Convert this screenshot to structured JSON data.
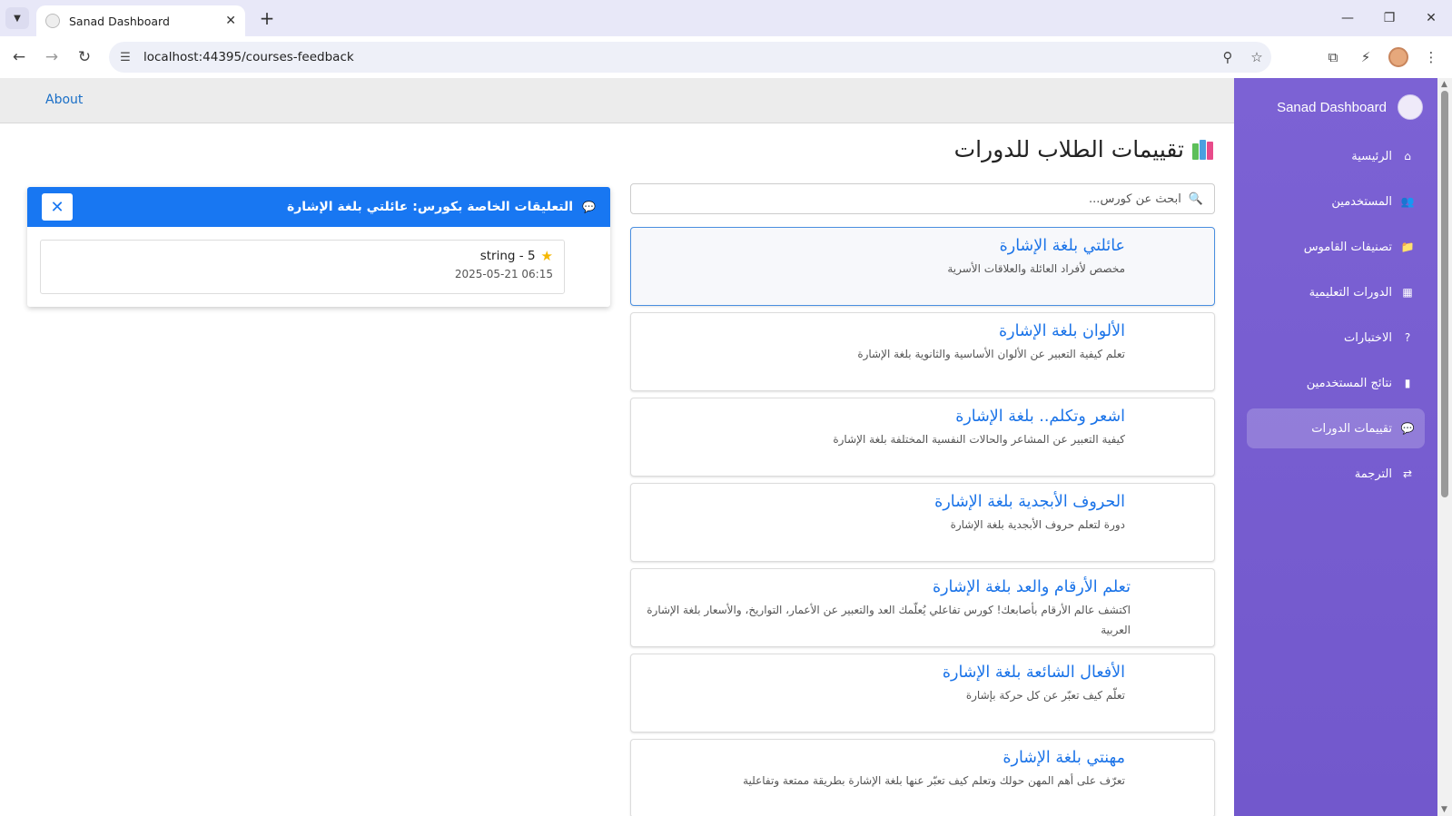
{
  "browser": {
    "tab_title": "Sanad Dashboard",
    "url": "localhost:44395/courses-feedback"
  },
  "topbar": {
    "about_label": "About"
  },
  "sidebar": {
    "brand": "Sanad Dashboard",
    "items": [
      {
        "label": "الرئيسية",
        "icon": "home-icon"
      },
      {
        "label": "المستخدمين",
        "icon": "users-icon"
      },
      {
        "label": "تصنيفات القاموس",
        "icon": "folder-icon"
      },
      {
        "label": "الدورات التعليمية",
        "icon": "board-icon"
      },
      {
        "label": "الاختبارات",
        "icon": "question-icon"
      },
      {
        "label": "نتائج المستخدمين",
        "icon": "chart-icon"
      },
      {
        "label": "تقييمات الدورات",
        "icon": "comment-icon"
      },
      {
        "label": "الترجمة",
        "icon": "translate-icon"
      }
    ],
    "active_index": 6
  },
  "main": {
    "title": "تقييمات الطلاب للدورات",
    "search_placeholder": "ابحث عن كورس...",
    "courses": [
      {
        "title": "عائلتي بلغة الإشارة",
        "desc": "مخصص لأفراد العائلة والعلاقات الأسرية"
      },
      {
        "title": "الألوان بلغة الإشارة",
        "desc": "تعلم كيفية التعبير عن الألوان الأساسية والثانوية بلغة الإشارة"
      },
      {
        "title": "اشعر وتكلم.. بلغة الإشارة",
        "desc": "كيفية التعبير عن المشاعر والحالات النفسية المختلفة بلغة الإشارة"
      },
      {
        "title": "الحروف الأبجدية بلغة الإشارة",
        "desc": "دورة لتعلم حروف الأبجدية بلغة الإشارة"
      },
      {
        "title": "تعلم الأرقام والعد بلغة الإشارة",
        "desc": "اكتشف عالم الأرقام بأصابعك! كورس تفاعلي يُعلّمك العد والتعبير عن الأعمار، التواريخ، والأسعار بلغة الإشارة العربية"
      },
      {
        "title": "الأفعال الشائعة بلغة الإشارة",
        "desc": "تعلّم كيف تعبّر عن كل حركة بإشارة"
      },
      {
        "title": "مهنتي بلغة الإشارة",
        "desc": "تعرّف على أهم المهن حولك وتعلم كيف تعبّر عنها بلغة الإشارة بطريقة ممتعة وتفاعلية"
      }
    ],
    "selected_index": 0
  },
  "comments": {
    "header": "التعليقات الخاصة بكورس: عائلتي بلغة الإشارة",
    "close_label": "✕",
    "items": [
      {
        "rating": "5 - string",
        "date": "2025-05-21 06:15"
      }
    ]
  }
}
